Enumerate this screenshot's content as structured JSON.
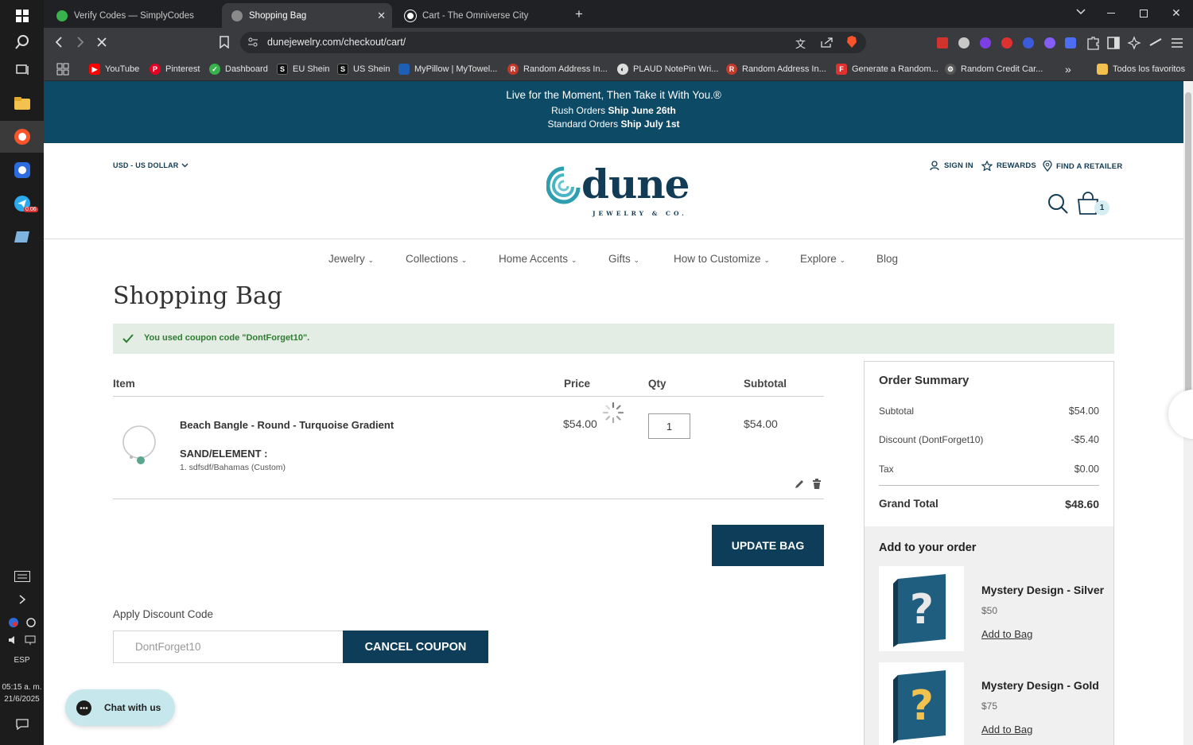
{
  "taskbar": {
    "lang": "ESP",
    "time": "05:15 a. m.",
    "date": "21/6/2025",
    "badge": "0.06"
  },
  "browser": {
    "tabs": [
      {
        "title": "Verify Codes — SimplyCodes",
        "fav_color": "#37b24d"
      },
      {
        "title": "Shopping Bag",
        "fav_color": "#8a8a8a"
      },
      {
        "title": "Cart - The Omniverse City",
        "fav_color": "#ffffff"
      }
    ],
    "url": "dunejewelry.com/checkout/cart/",
    "bookmarks": [
      {
        "label": "YouTube",
        "icon": "youtube-icon",
        "color": "#ff0000"
      },
      {
        "label": "Pinterest",
        "icon": "pinterest-icon",
        "color": "#e60023"
      },
      {
        "label": "Dashboard",
        "icon": "simplycodes-icon",
        "color": "#37b24d"
      },
      {
        "label": "EU Shein",
        "icon": "shein-icon",
        "color": "#111111"
      },
      {
        "label": "US Shein",
        "icon": "shein-icon",
        "color": "#111111"
      },
      {
        "label": "MyPillow | MyTowel...",
        "icon": "mypillow-icon",
        "color": "#1d5fb5"
      },
      {
        "label": "Random Address In...",
        "icon": "random-address-icon",
        "color": "#c0392b"
      },
      {
        "label": "PLAUD NotePin Wri...",
        "icon": "plaud-icon",
        "color": "#dddddd"
      },
      {
        "label": "Random Address In...",
        "icon": "random-address-icon",
        "color": "#c0392b"
      },
      {
        "label": "Generate a Random...",
        "icon": "generator-icon",
        "color": "#e03131"
      },
      {
        "label": "Random Credit Car...",
        "icon": "gear-icon",
        "color": "#888888"
      }
    ],
    "bookmarks_more": "»",
    "all_bookmarks": "Todos los favoritos"
  },
  "promo": {
    "line1": "Live for the Moment, Then Take it With You.®",
    "line2_prefix": "Rush Orders ",
    "line2_bold": "Ship June 26th",
    "line3_prefix": "Standard Orders ",
    "line3_bold": "Ship July 1st"
  },
  "header": {
    "currency": "USD - US DOLLAR",
    "logo_word": "dune",
    "logo_sub": "JEWELRY & CO.",
    "sign_in": "SIGN IN",
    "rewards": "REWARDS",
    "find_retailer": "FIND A RETAILER",
    "cart_count": "1"
  },
  "nav": [
    "Jewelry",
    "Collections",
    "Home Accents",
    "Gifts",
    "How to Customize",
    "Explore",
    "Blog"
  ],
  "page_title": "Shopping Bag",
  "notice": "You used coupon code \"DontForget10\".",
  "cart": {
    "headers": {
      "item": "Item",
      "price": "Price",
      "qty": "Qty",
      "subtotal": "Subtotal"
    },
    "item": {
      "name": "Beach Bangle - Round - Turquoise Gradient",
      "option_label": "SAND/ELEMENT :",
      "option_value": "1. sdfsdf/Bahamas (Custom)",
      "price": "$54.00",
      "qty": "1",
      "subtotal": "$54.00"
    },
    "update_button": "UPDATE BAG"
  },
  "discount": {
    "label": "Apply Discount Code",
    "value": "DontForget10",
    "button": "CANCEL COUPON"
  },
  "chat": "Chat with us",
  "summary": {
    "title": "Order Summary",
    "rows": [
      {
        "label": "Subtotal",
        "value": "$54.00"
      },
      {
        "label": "Discount (DontForget10)",
        "value": "-$5.40"
      },
      {
        "label": "Tax",
        "value": "$0.00"
      }
    ],
    "grand_label": "Grand Total",
    "grand_value": "$48.60"
  },
  "add_to_order": {
    "title": "Add to your order",
    "products": [
      {
        "name": "Mystery Design - Silver",
        "price": "$50",
        "link": "Add to Bag"
      },
      {
        "name": "Mystery Design - Gold",
        "price": "$75",
        "link": "Add to Bag"
      }
    ]
  },
  "colors": {
    "navy": "#0d3d58",
    "promo": "#0d4a66",
    "notice_bg": "#e4ede4",
    "notice_text": "#2e7d32"
  }
}
